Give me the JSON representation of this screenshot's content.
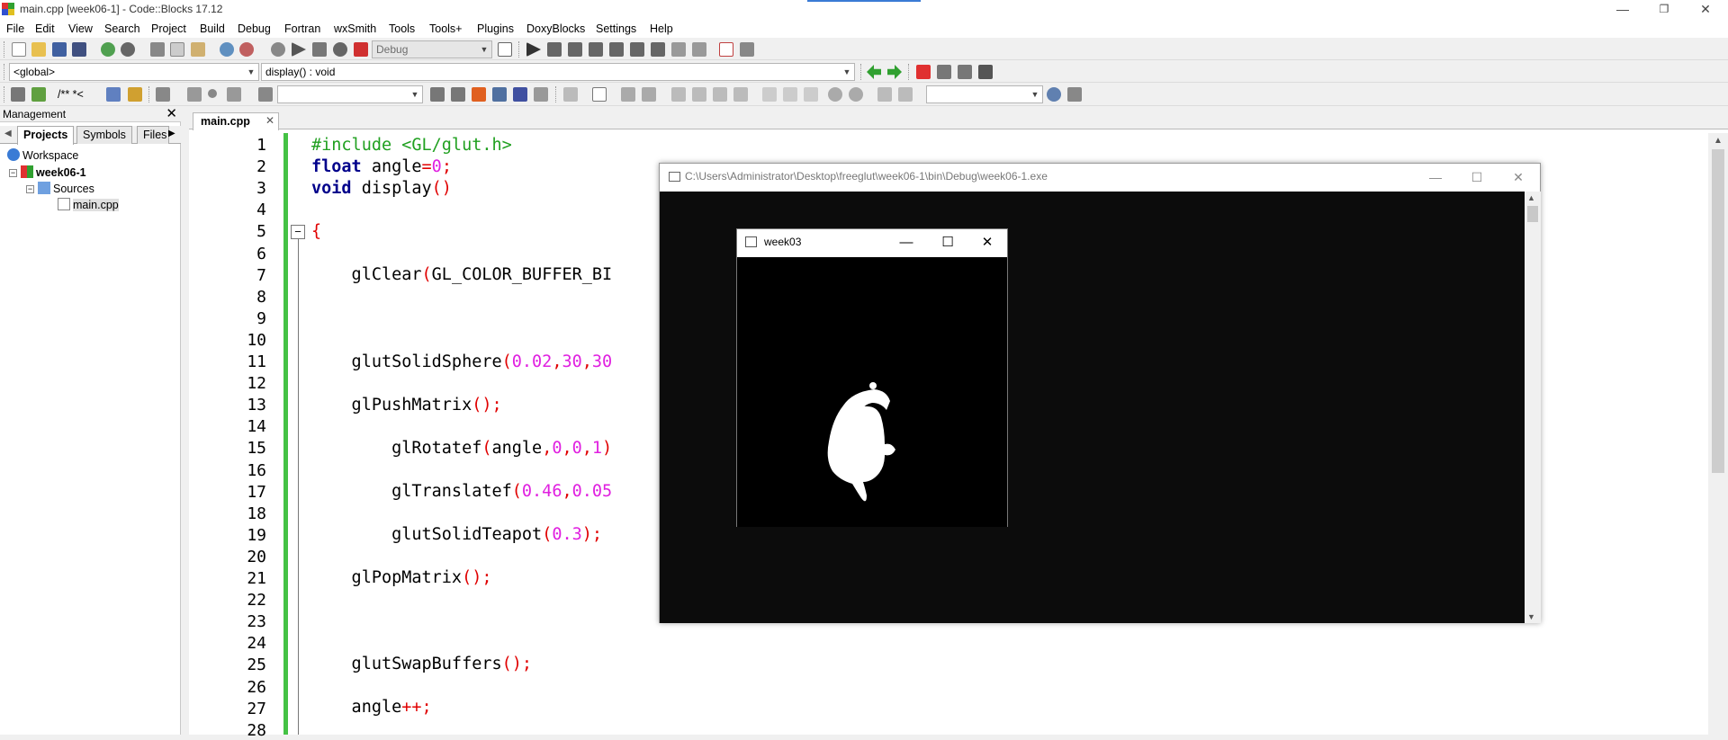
{
  "window": {
    "title": "main.cpp [week06-1] - Code::Blocks 17.12",
    "minimize": "—",
    "restore": "❐",
    "close": "✕"
  },
  "menu": [
    "File",
    "Edit",
    "View",
    "Search",
    "Project",
    "Build",
    "Debug",
    "Fortran",
    "wxSmith",
    "Tools",
    "Tools+",
    "Plugins",
    "DoxyBlocks",
    "Settings",
    "Help"
  ],
  "toolbar": {
    "build_target": "Debug",
    "scope_combo": "<global>",
    "function_combo": "display() : void",
    "doxy_comment": "/** *<"
  },
  "management": {
    "title": "Management",
    "close": "✕",
    "tabs": [
      "Projects",
      "Symbols",
      "Files"
    ],
    "tree": {
      "workspace": "Workspace",
      "project": "week06-1",
      "folder": "Sources",
      "file": "main.cpp"
    }
  },
  "editor": {
    "tab_label": "main.cpp",
    "tab_close": "✕",
    "line_numbers": [
      "1",
      "2",
      "3",
      "4",
      "5",
      "6",
      "7",
      "8",
      "9",
      "10",
      "11",
      "12",
      "13",
      "14",
      "15",
      "16",
      "17",
      "18",
      "19",
      "20",
      "21",
      "22",
      "23",
      "24",
      "25",
      "26",
      "27",
      "28"
    ],
    "code": {
      "l1": "#include <GL/glut.h>",
      "l2_kw": "float",
      "l2_rest": " angle",
      "l2_op": "=",
      "l2_num": "0",
      "l2_end": ";",
      "l3_kw": "void",
      "l3_rest": " display",
      "l3_op": "()",
      "l5": "{",
      "l7_a": "    glClear",
      "l7_b": "(",
      "l7_c": "GL_COLOR_BUFFER_BI",
      "l11_a": "    glutSolidSphere",
      "l11_b": "(",
      "l11_c": "0.02",
      "l11_d": ",",
      "l11_e": "30",
      "l11_f": ",",
      "l11_g": "30",
      "l13_a": "    glPushMatrix",
      "l13_b": "();",
      "l15_a": "        glRotatef",
      "l15_b": "(",
      "l15_c": "angle",
      "l15_d": ",",
      "l15_e": "0",
      "l15_f": ",",
      "l15_g": "0",
      "l15_h": ",",
      "l15_i": "1",
      "l15_j": ")",
      "l17_a": "        glTranslatef",
      "l17_b": "(",
      "l17_c": "0.46",
      "l17_d": ",",
      "l17_e": "0.05",
      "l19_a": "        glutSolidTeapot",
      "l19_b": "(",
      "l19_c": "0.3",
      "l19_d": ");",
      "l21_a": "    glPopMatrix",
      "l21_b": "();",
      "l25_a": "    glutSwapBuffers",
      "l25_b": "();",
      "l27_a": "    angle",
      "l27_b": "++;"
    }
  },
  "console_window": {
    "title": "C:\\Users\\Administrator\\Desktop\\freeglut\\week06-1\\bin\\Debug\\week06-1.exe",
    "minimize": "—",
    "maximize": "☐",
    "close": "✕"
  },
  "glut_window": {
    "title": "week03",
    "minimize": "—",
    "maximize": "☐",
    "close": "✕"
  },
  "colors": {
    "keyword": "#00008b",
    "preprocessor": "#20a020",
    "number": "#e020e0",
    "operator": "#e00000",
    "change_bar": "#44c244"
  }
}
